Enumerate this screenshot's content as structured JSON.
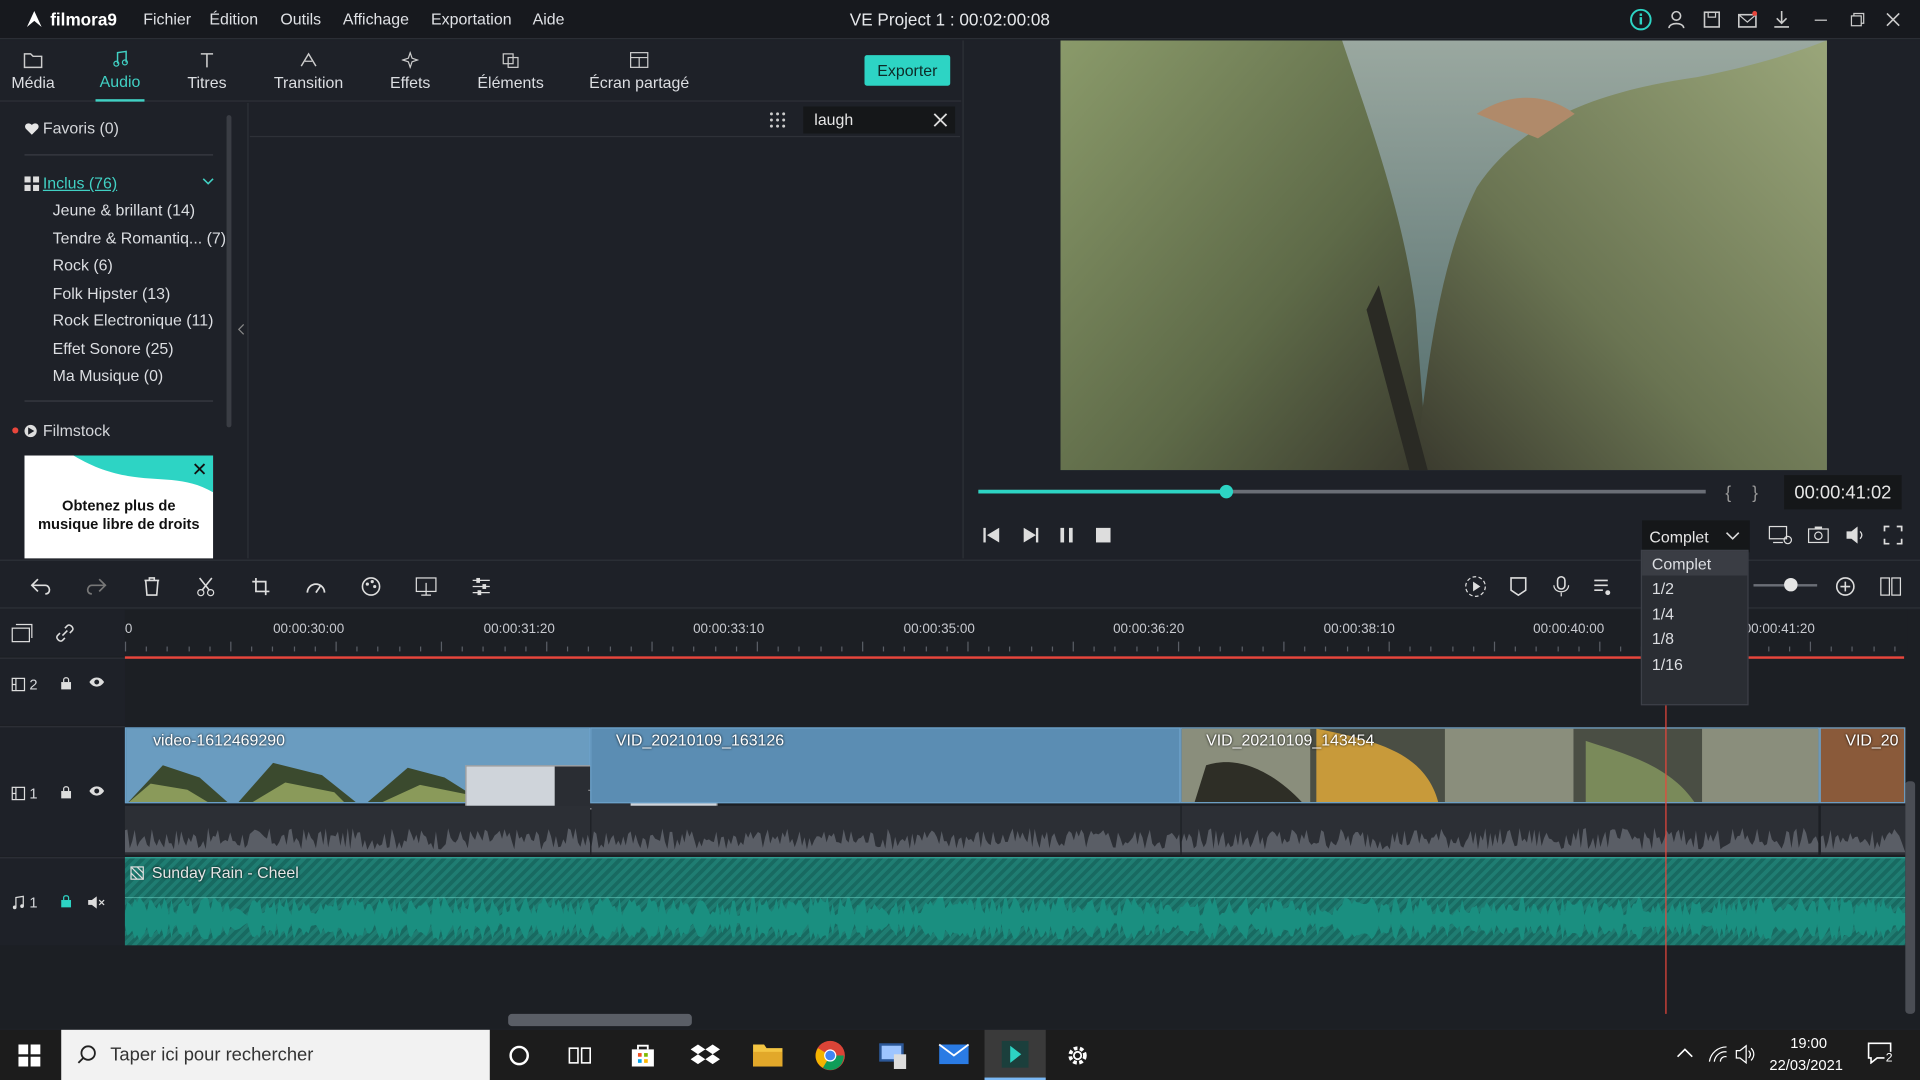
{
  "app": {
    "name": "filmora9",
    "project_title": "VE Project 1 : 00:02:00:08"
  },
  "menu": [
    "Fichier",
    "Édition",
    "Outils",
    "Affichage",
    "Exportation",
    "Aide"
  ],
  "tabs": [
    {
      "label": "Média",
      "icon": "folder-icon"
    },
    {
      "label": "Audio",
      "icon": "music-note-icon",
      "active": true
    },
    {
      "label": "Titres",
      "icon": "text-icon"
    },
    {
      "label": "Transition",
      "icon": "transition-icon"
    },
    {
      "label": "Effets",
      "icon": "effects-icon"
    },
    {
      "label": "Éléments",
      "icon": "elements-icon"
    },
    {
      "label": "Écran partagé",
      "icon": "split-screen-icon"
    }
  ],
  "export_label": "Exporter",
  "library": {
    "favorites": "Favoris (0)",
    "included": "Inclus (76)",
    "items": [
      "Jeune & brillant (14)",
      "Tendre & Romantiq... (7)",
      "Rock (6)",
      "Folk Hipster (13)",
      "Rock Electronique (11)",
      "Effet Sonore (25)",
      "Ma Musique (0)"
    ],
    "filmstock": "Filmstock",
    "ad_text": "Obtenez plus de musique libre de droits"
  },
  "search": {
    "value": "laugh"
  },
  "preview": {
    "timecode": "00:00:41:02",
    "progress": 0.34,
    "quality_selected": "Complet"
  },
  "quality_options": [
    "Complet",
    "1/2",
    "1/4",
    "1/8",
    "1/16"
  ],
  "ruler_labels": [
    "0",
    "00:00:30:00",
    "00:00:31:20",
    "00:00:33:10",
    "00:00:35:00",
    "00:00:36:20",
    "00:00:38:10",
    "00:00:40:00",
    "00:00:41:20"
  ],
  "tracks": {
    "video2": "2",
    "video1": "1",
    "audio1": "1"
  },
  "clips": [
    "video-1612469290",
    "VID_20210109_163126",
    "VID_20210109_143454",
    "VID_20"
  ],
  "music_clip": "Sunday Rain - Cheel",
  "taskbar": {
    "search_placeholder": "Taper ici pour rechercher",
    "time": "19:00",
    "date": "22/03/2021",
    "notifications": "2"
  },
  "colors": {
    "accent": "#2dd4c4",
    "playhead": "#e8463c",
    "clip_blue": "#3a6d8f",
    "music_teal": "#1f7d72"
  }
}
